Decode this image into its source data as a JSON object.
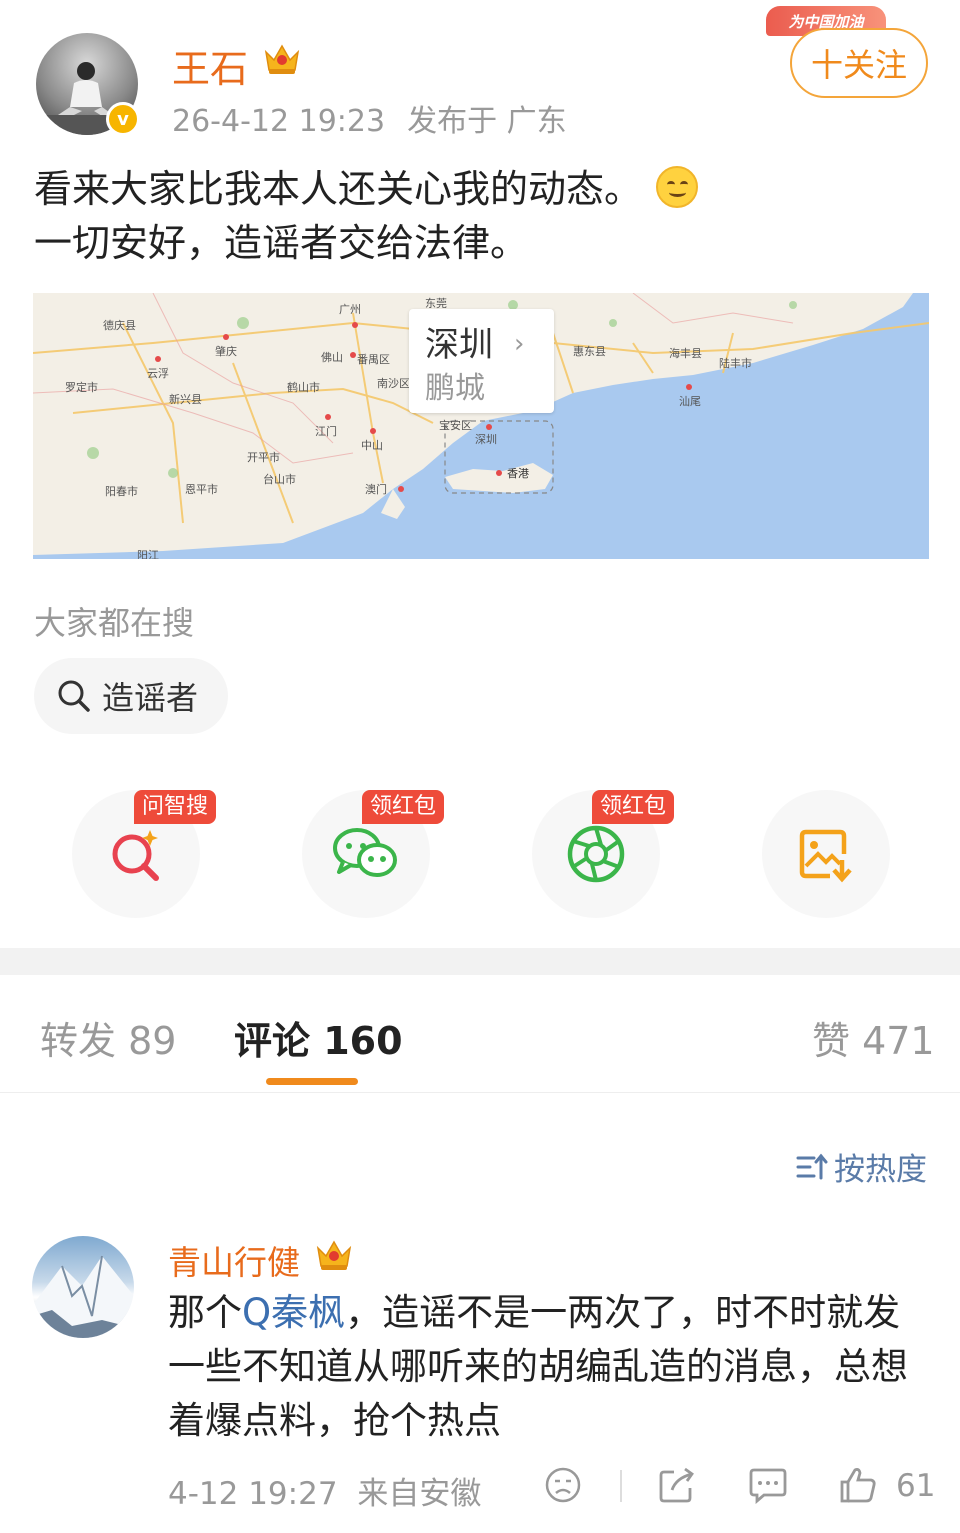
{
  "post": {
    "username": "王石",
    "timestamp": "26-4-12 19:23",
    "location": "发布于 广东",
    "verified_badge": "v",
    "follow_label": "十关注",
    "promo_banner": "为中国加油",
    "text_line1": "看来大家比我本人还关心我的动态。",
    "text_line2": "一切安好，造谣者交给法律。",
    "emoji": "smile-emoji"
  },
  "map": {
    "city": "深圳",
    "alias": "鹏城",
    "places": [
      "广州",
      "肇庆",
      "云浮",
      "佛山",
      "江门",
      "中山",
      "澳门",
      "香港",
      "深圳",
      "汕尾",
      "阳江",
      "开平市",
      "台山市",
      "恩平市",
      "阳春市",
      "新兴县",
      "罗定市",
      "德庆县",
      "鹤山市",
      "番禺区",
      "东莞",
      "惠东县",
      "海丰县",
      "陆丰市",
      "宝安区",
      "南沙区"
    ]
  },
  "trending": {
    "title": "大家都在搜",
    "query": "造谣者"
  },
  "actions": {
    "ask_tag": "问智搜",
    "wechat_tag": "领红包",
    "moments_tag": "领红包"
  },
  "tabs": {
    "repost": "转发 89",
    "comments": "评论 160",
    "likes": "赞 471"
  },
  "sort_label": "按热度",
  "comment": {
    "username": "青山行健",
    "text_before": "那个",
    "mention": "Q秦枫",
    "text_after": "，造谣不是一两次了，时不时就发一些不知道从哪听来的胡编乱造的消息，总想着爆点料，抢个热点",
    "time": "4-12 19:27",
    "source": "来自安徽",
    "likes": "61"
  },
  "colors": {
    "accent": "#f08a1c",
    "username": "#e86b1c",
    "link": "#3c6fb0",
    "sea": "#a9c9ef",
    "red_tag": "#ee4b3a"
  }
}
